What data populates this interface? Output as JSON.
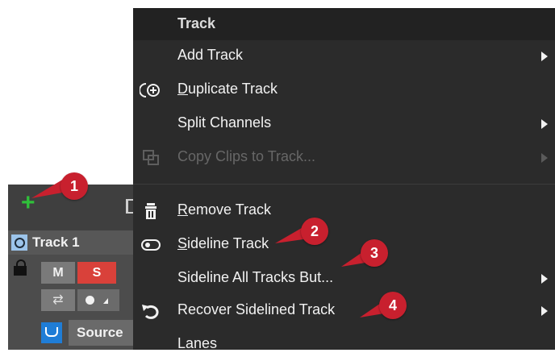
{
  "track_panel": {
    "track_name": "Track 1",
    "mute_label": "M",
    "solo_label": "S",
    "route_symbol": "⇄",
    "source_label": "Source",
    "colors": {
      "add": "#2fbf3a",
      "solo": "#d9413a",
      "source_icon": "#1f7dd6"
    }
  },
  "menu": {
    "header": "Track",
    "items": [
      {
        "label": "Add Track",
        "has_submenu": true,
        "enabled": true,
        "icon": ""
      },
      {
        "label": "Duplicate Track",
        "mnemonic": "D",
        "rest": "uplicate Track",
        "has_submenu": false,
        "enabled": true,
        "icon": "duplicate-icon"
      },
      {
        "label": "Split Channels",
        "has_submenu": true,
        "enabled": true,
        "icon": ""
      },
      {
        "label": "Copy Clips to Track...",
        "has_submenu": true,
        "enabled": false,
        "icon": "copy-icon"
      },
      {
        "label": "Remove Track",
        "mnemonic": "R",
        "rest": "emove Track",
        "has_submenu": false,
        "enabled": true,
        "icon": "trash-icon"
      },
      {
        "label": "Sideline Track",
        "mnemonic": "S",
        "rest": "ideline Track",
        "has_submenu": false,
        "enabled": true,
        "icon": "toggle-icon"
      },
      {
        "label": "Sideline All Tracks But...",
        "has_submenu": true,
        "enabled": true,
        "icon": ""
      },
      {
        "label": "Recover Sidelined Track",
        "has_submenu": true,
        "enabled": true,
        "icon": "undo-icon"
      },
      {
        "label": "Lanes",
        "has_submenu": false,
        "enabled": true,
        "icon": ""
      }
    ]
  },
  "callouts": [
    "1",
    "2",
    "3",
    "4"
  ],
  "colors": {
    "callout": "#c8202e",
    "menu_bg": "#2b2b2b"
  }
}
